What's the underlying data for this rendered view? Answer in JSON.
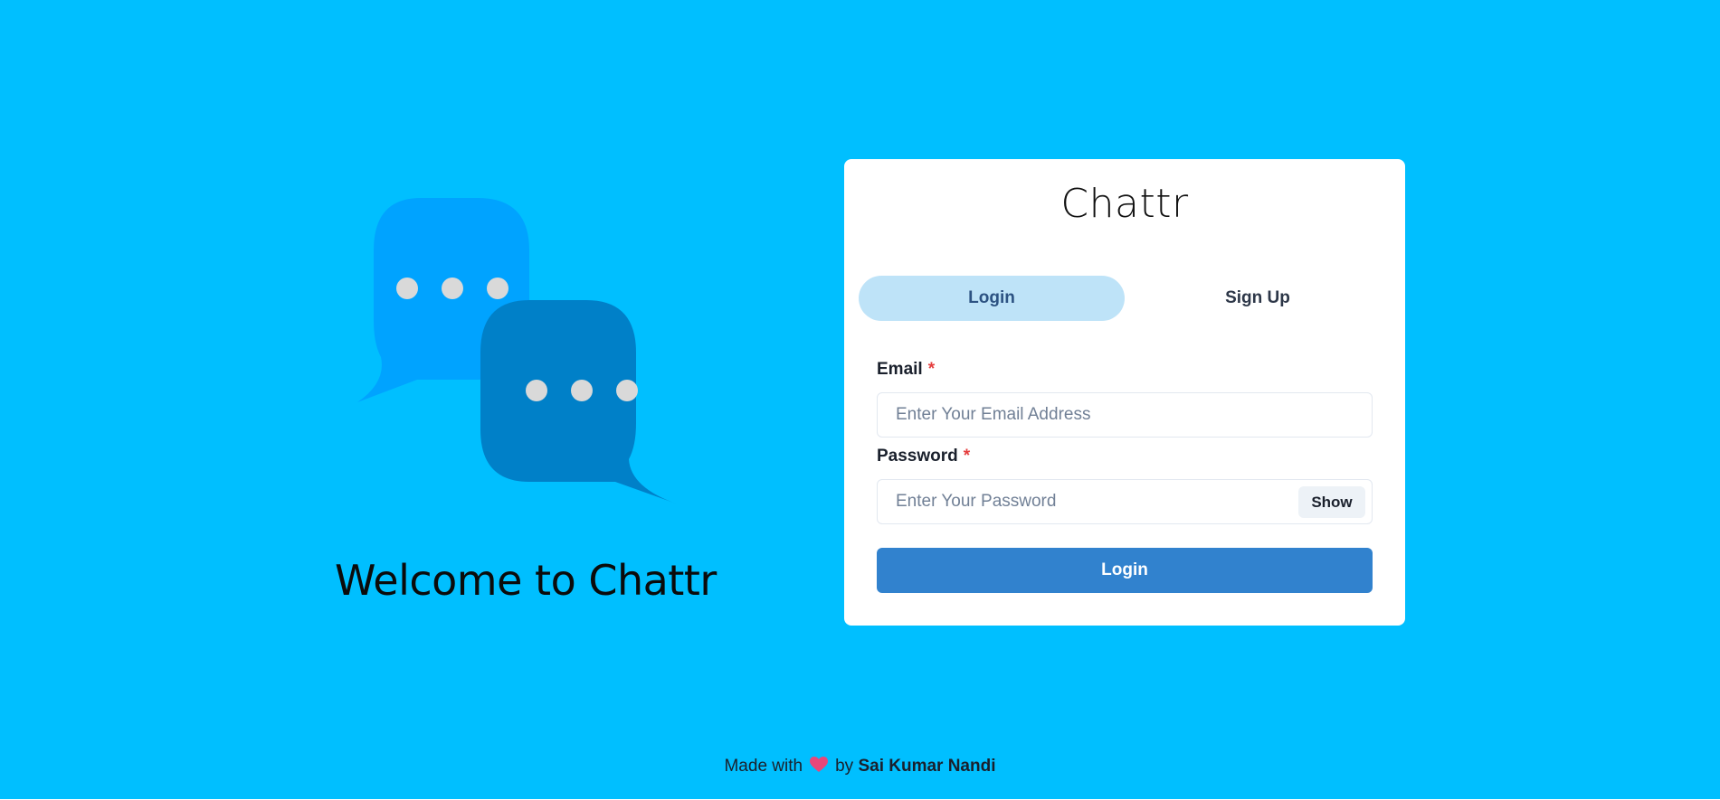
{
  "hero": {
    "title": "Welcome to Chattr",
    "illustration": "chat-bubbles-illustration",
    "colors": {
      "background": "#00BFFF",
      "bubble_back": "#00A3FF",
      "bubble_front": "#0080C8",
      "dots": "#D9D9D9"
    }
  },
  "card": {
    "brand": "Chattr",
    "tabs": [
      {
        "label": "Login",
        "active": true
      },
      {
        "label": "Sign Up",
        "active": false
      }
    ],
    "email": {
      "label": "Email",
      "required_mark": "*",
      "placeholder": "Enter Your Email Address",
      "value": ""
    },
    "password": {
      "label": "Password",
      "required_mark": "*",
      "placeholder": "Enter Your Password",
      "value": "",
      "toggle_label": "Show"
    },
    "submit_label": "Login",
    "colors": {
      "tab_active_bg": "#BEE3F8",
      "submit_bg": "#3182CE",
      "required": "#E53E3E"
    }
  },
  "footer": {
    "prefix": "Made with",
    "icon": "heart-icon",
    "by": "by",
    "author": "Sai Kumar Nandi"
  }
}
